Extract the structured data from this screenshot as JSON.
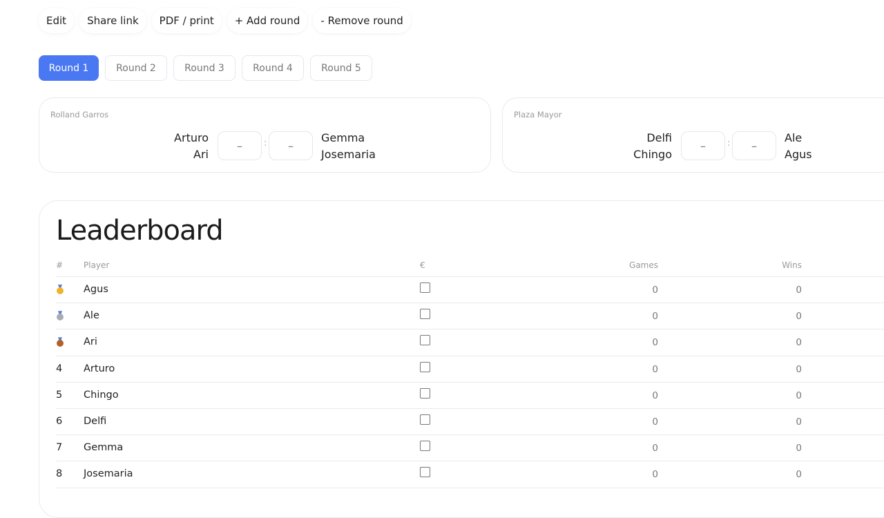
{
  "toolbar": {
    "edit": "Edit",
    "share": "Share link",
    "pdf": "PDF / print",
    "add_round": "+ Add round",
    "remove_round": "- Remove round"
  },
  "rounds": [
    "Round 1",
    "Round 2",
    "Round 3",
    "Round 4",
    "Round 5"
  ],
  "active_round": "Round 1",
  "matches": [
    {
      "court": "Rolland Garros",
      "team_a": [
        "Arturo",
        "Ari"
      ],
      "team_b": [
        "Gemma",
        "Josemaria"
      ],
      "score_a": "–",
      "score_b": "–",
      "separator": ":"
    },
    {
      "court": "Plaza Mayor",
      "team_a": [
        "Delfi",
        "Chingo"
      ],
      "team_b": [
        "Ale",
        "Agus"
      ],
      "score_a": "–",
      "score_b": "–",
      "separator": ":"
    }
  ],
  "leaderboard": {
    "title": "Leaderboard",
    "columns": {
      "rank": "#",
      "player": "Player",
      "paid": "€",
      "games": "Games",
      "wins": "Wins"
    },
    "rows": [
      {
        "rank": "",
        "medal": "gold",
        "player": "Agus",
        "paid": false,
        "games": "0",
        "wins": "0"
      },
      {
        "rank": "",
        "medal": "silver",
        "player": "Ale",
        "paid": false,
        "games": "0",
        "wins": "0"
      },
      {
        "rank": "",
        "medal": "bronze",
        "player": "Ari",
        "paid": false,
        "games": "0",
        "wins": "0"
      },
      {
        "rank": "4",
        "medal": "",
        "player": "Arturo",
        "paid": false,
        "games": "0",
        "wins": "0"
      },
      {
        "rank": "5",
        "medal": "",
        "player": "Chingo",
        "paid": false,
        "games": "0",
        "wins": "0"
      },
      {
        "rank": "6",
        "medal": "",
        "player": "Delfi",
        "paid": false,
        "games": "0",
        "wins": "0"
      },
      {
        "rank": "7",
        "medal": "",
        "player": "Gemma",
        "paid": false,
        "games": "0",
        "wins": "0"
      },
      {
        "rank": "8",
        "medal": "",
        "player": "Josemaria",
        "paid": false,
        "games": "0",
        "wins": "0"
      }
    ]
  },
  "colors": {
    "accent": "#4a78f2",
    "gold": "#f0b429",
    "silver": "#a9adb3",
    "bronze": "#b0622a",
    "border": "#e8eaee"
  }
}
